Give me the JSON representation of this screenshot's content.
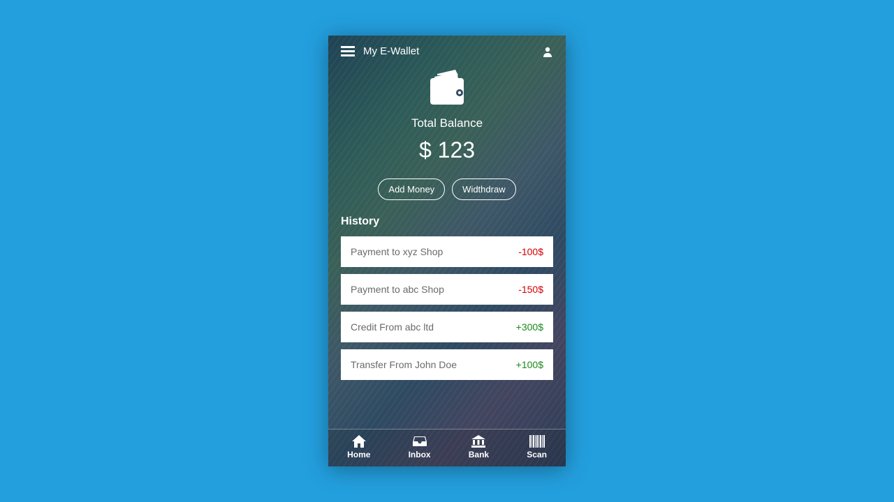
{
  "header": {
    "title": "My E-Wallet"
  },
  "balance": {
    "label": "Total Balance",
    "amount": "$ 123"
  },
  "buttons": {
    "add_money": "Add Money",
    "withdraw": "Widthdraw"
  },
  "history": {
    "title": "History",
    "items": [
      {
        "desc": "Payment to xyz Shop",
        "amount": "-100$",
        "sign": "neg"
      },
      {
        "desc": "Payment to abc Shop",
        "amount": "-150$",
        "sign": "neg"
      },
      {
        "desc": "Credit From abc ltd",
        "amount": "+300$",
        "sign": "pos"
      },
      {
        "desc": "Transfer From John Doe",
        "amount": "+100$",
        "sign": "pos"
      }
    ]
  },
  "nav": {
    "items": [
      {
        "label": "Home"
      },
      {
        "label": "Inbox"
      },
      {
        "label": "Bank"
      },
      {
        "label": "Scan"
      }
    ]
  }
}
